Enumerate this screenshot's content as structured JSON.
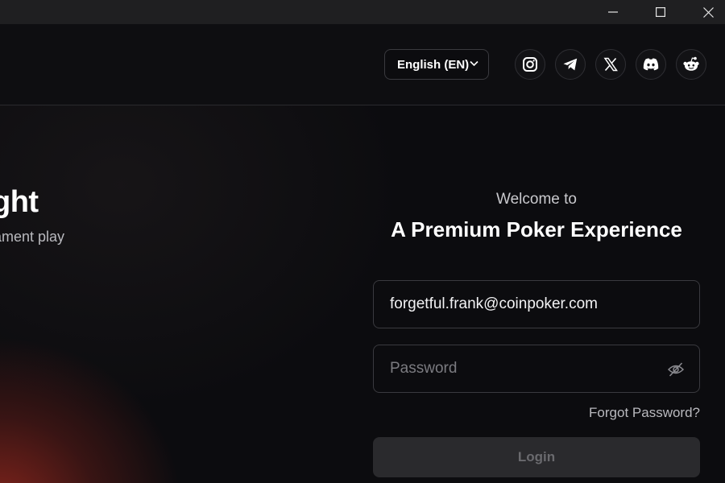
{
  "window": {
    "controls": [
      {
        "name": "minimize",
        "icon": "minimize-icon"
      },
      {
        "name": "maximize",
        "icon": "maximize-icon"
      },
      {
        "name": "close",
        "icon": "close-icon"
      }
    ]
  },
  "header": {
    "language_label": "English (EN)",
    "social_links": [
      "instagram-icon",
      "telegram-icon",
      "x-icon",
      "discord-icon",
      "reddit-icon"
    ]
  },
  "hero": {
    "title_partial": "ght",
    "subtitle_partial": "ament play"
  },
  "login": {
    "welcome_text": "Welcome to",
    "headline": "A Premium Poker Experience",
    "email_value": "forgetful.frank@coinpoker.com",
    "password_placeholder": "Password",
    "forgot_label": "Forgot Password?",
    "login_label": "Login"
  },
  "colors": {
    "background": "#0c0c0f",
    "accent_glow": "#96281e",
    "button_disabled_bg": "#2a2a2d",
    "button_disabled_text": "#6a6a6e"
  }
}
